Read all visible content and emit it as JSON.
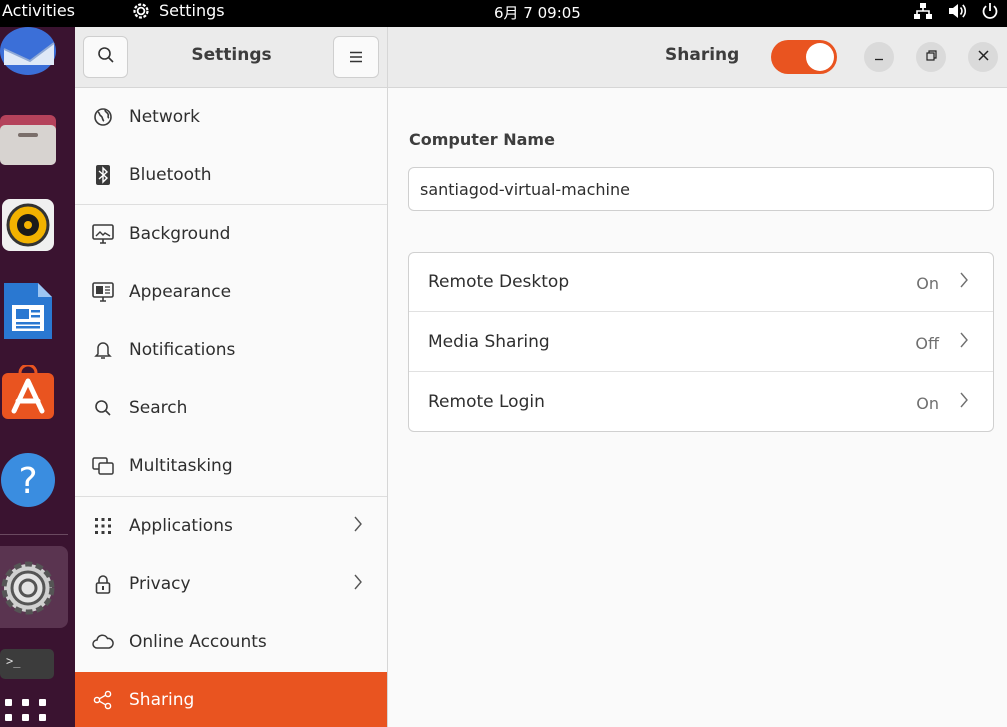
{
  "topbar": {
    "activities": "Activities",
    "app_name": "Settings",
    "clock": "6月 7  09:05",
    "tray_icons": [
      "network-icon",
      "volume-icon",
      "power-icon"
    ]
  },
  "dock": {
    "items": [
      "thunderbird-icon",
      "files-icon",
      "rhythmbox-icon",
      "libreoffice-writer-icon",
      "app-center-icon",
      "help-icon",
      "settings-icon",
      "terminal-icon",
      "show-apps-icon"
    ]
  },
  "sidebar": {
    "title": "Settings",
    "items": [
      {
        "label": "Network",
        "icon": "globe-icon"
      },
      {
        "label": "Bluetooth",
        "icon": "bluetooth-icon"
      },
      {
        "label": "Background",
        "icon": "background-icon"
      },
      {
        "label": "Appearance",
        "icon": "appearance-icon"
      },
      {
        "label": "Notifications",
        "icon": "bell-icon"
      },
      {
        "label": "Search",
        "icon": "search-icon"
      },
      {
        "label": "Multitasking",
        "icon": "multitasking-icon"
      },
      {
        "label": "Applications",
        "icon": "apps-grid-icon"
      },
      {
        "label": "Privacy",
        "icon": "lock-icon"
      },
      {
        "label": "Online Accounts",
        "icon": "cloud-icon"
      },
      {
        "label": "Sharing",
        "icon": "share-icon"
      }
    ],
    "selected": "Sharing"
  },
  "main": {
    "title": "Sharing",
    "sharing_enabled": true,
    "computer_name_label": "Computer Name",
    "computer_name_value": "santiagod-virtual-machine",
    "rows": [
      {
        "label": "Remote Desktop",
        "status": "On"
      },
      {
        "label": "Media Sharing",
        "status": "Off"
      },
      {
        "label": "Remote Login",
        "status": "On"
      }
    ]
  },
  "colors": {
    "accent": "#e95420",
    "topbar": "#000000",
    "dock": "#3a1330"
  }
}
